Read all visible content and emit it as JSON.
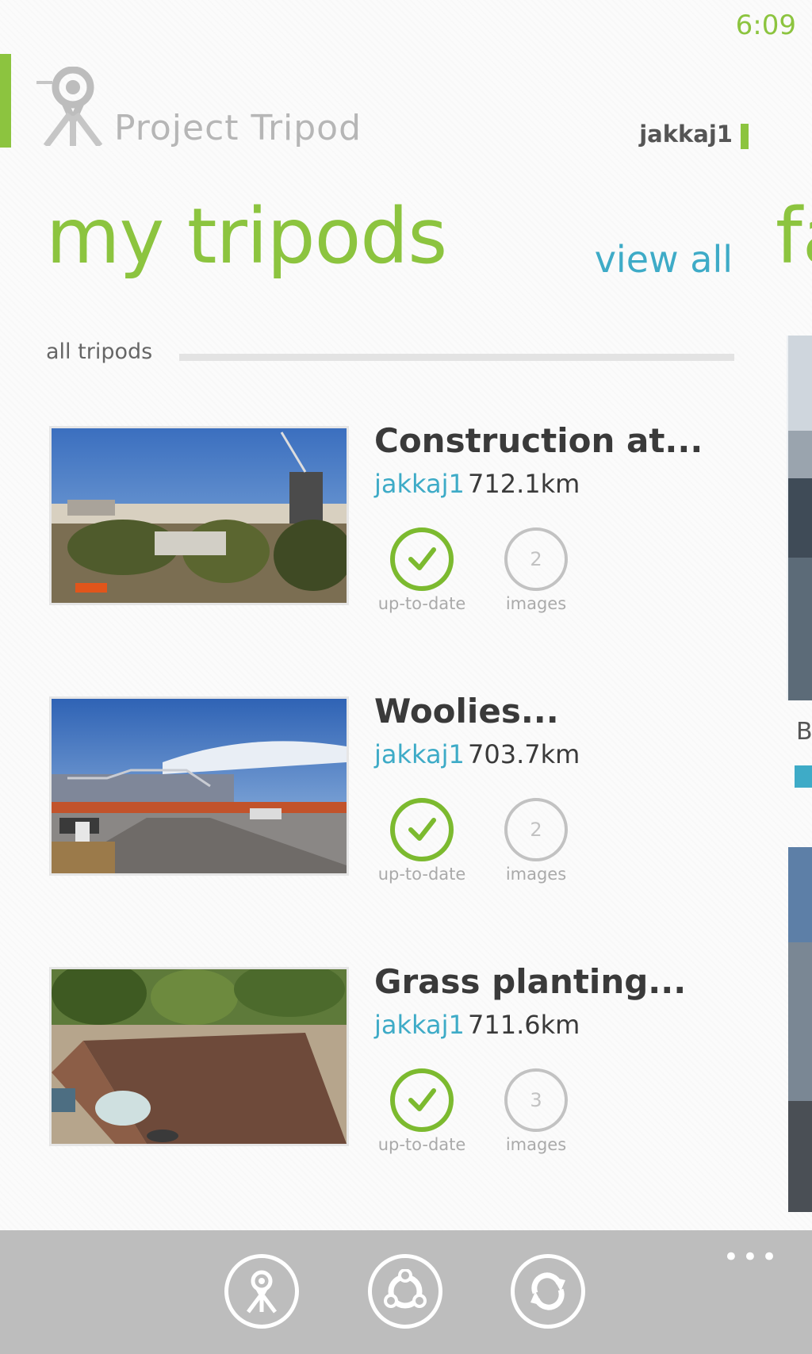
{
  "status": {
    "time": "6:09"
  },
  "header": {
    "logo_text": "Project Tripod",
    "username": "jakkaj1"
  },
  "section": {
    "title": "my tripods",
    "view_all": "view all",
    "next_title": "fa",
    "subheader": "all tripods"
  },
  "tripods": [
    {
      "title": "Construction at...",
      "owner": "jakkaj1",
      "distance": "712.1km",
      "status_label": "up-to-date",
      "image_count": "2",
      "images_label": "images"
    },
    {
      "title": "Woolies...",
      "owner": "jakkaj1",
      "distance": "703.7km",
      "status_label": "up-to-date",
      "image_count": "2",
      "images_label": "images"
    },
    {
      "title": "Grass planting...",
      "owner": "jakkaj1",
      "distance": "711.6km",
      "status_label": "up-to-date",
      "image_count": "3",
      "images_label": "images"
    }
  ],
  "right_panel": {
    "partial_text": "B"
  },
  "appbar": {
    "more": "•••"
  },
  "icons": [
    "tripod-logo-icon",
    "check-icon",
    "tripod-icon",
    "share-icon",
    "sync-icon"
  ],
  "colors": {
    "accent_green": "#8cc43f",
    "link_blue": "#3eabc7",
    "appbar_gray": "#bdbdbd"
  }
}
